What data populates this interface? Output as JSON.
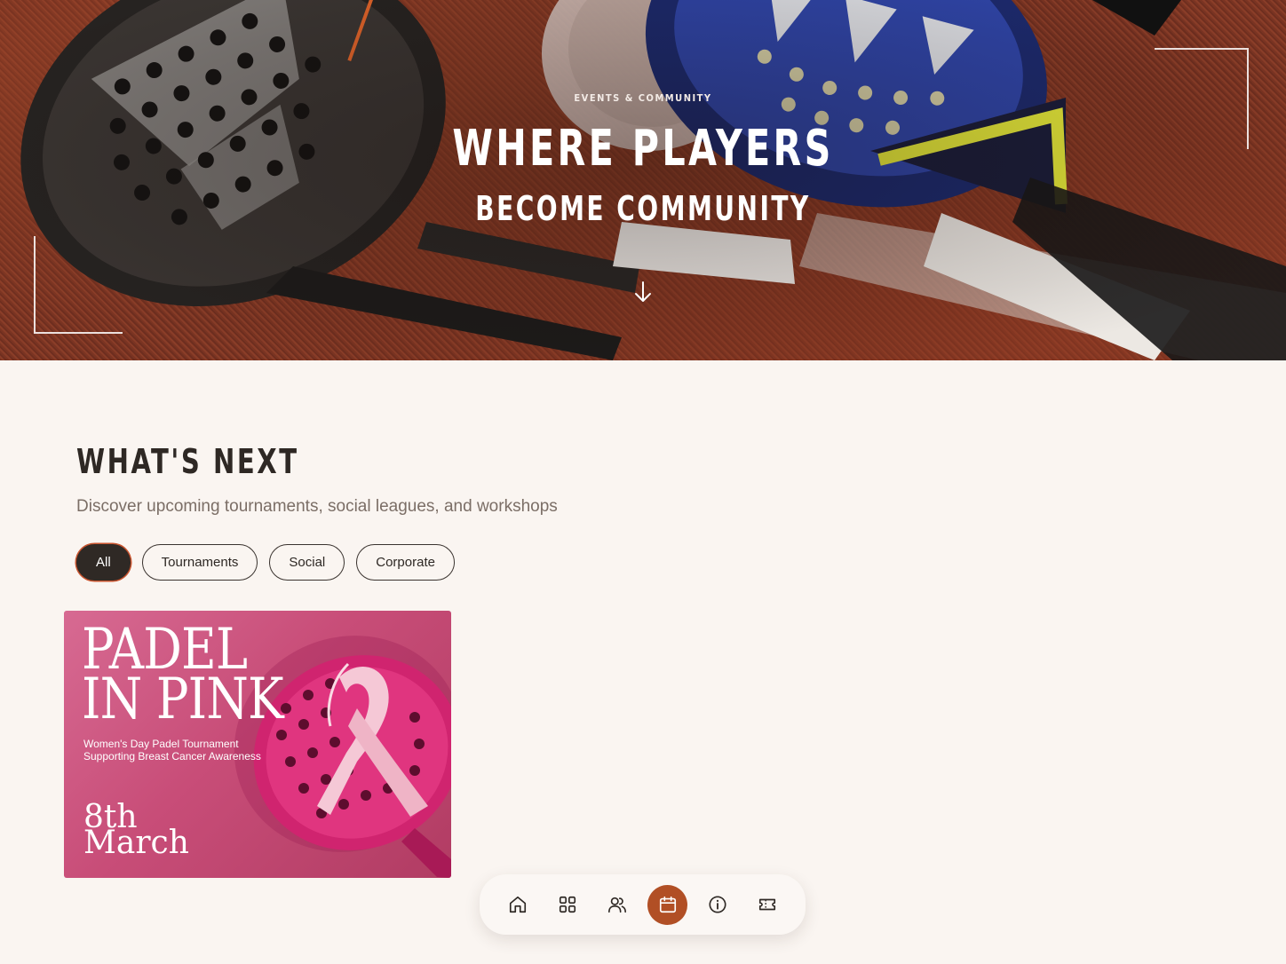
{
  "hero": {
    "eyebrow": "EVENTS & COMMUNITY",
    "title": "WHERE PLAYERS",
    "subtitle": "BECOME COMMUNITY"
  },
  "section": {
    "title": "WHAT'S NEXT",
    "description": "Discover upcoming tournaments, social leagues, and workshops"
  },
  "filters": {
    "all": "All",
    "tournaments": "Tournaments",
    "social": "Social",
    "corporate": "Corporate",
    "active": "All"
  },
  "event_card": {
    "title_line1": "PADEL",
    "title_line2": "IN PINK",
    "subtitle": "Women's Day Padel Tournament Supporting Breast Cancer Awareness",
    "date_day": "8th",
    "date_month": "March"
  },
  "bottom_nav": {
    "items": [
      "home-icon",
      "grid-icon",
      "users-icon",
      "calendar-icon",
      "info-icon",
      "ticket-icon"
    ],
    "active": "calendar-icon"
  },
  "colors": {
    "background": "#faf5f1",
    "accent": "#b14f25",
    "text_dark": "#2e2824",
    "text_muted": "#7b6e66",
    "card_pink": "#c84d78"
  }
}
